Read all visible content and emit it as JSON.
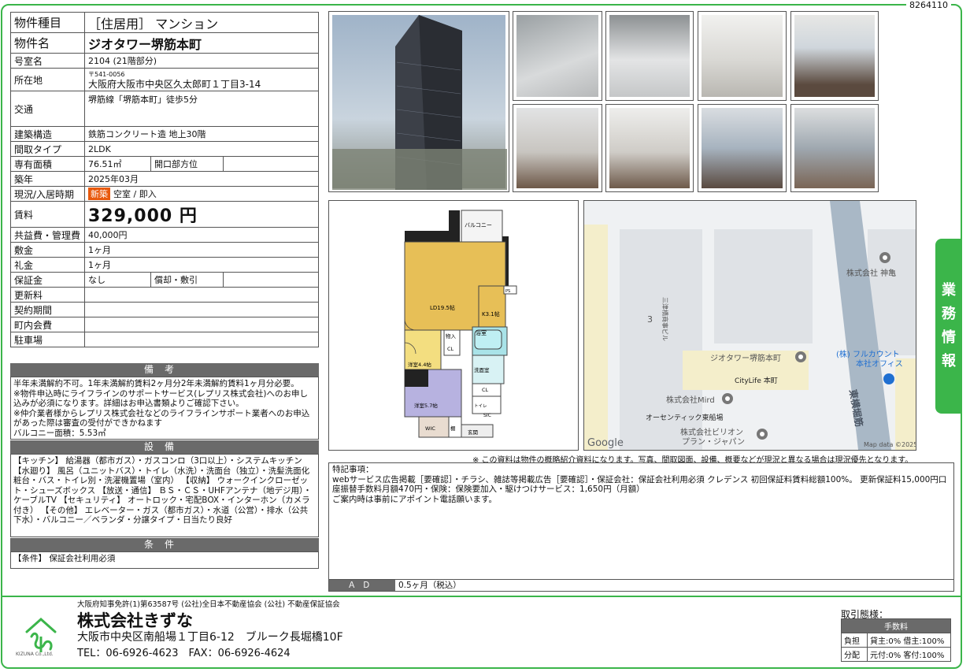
{
  "doc_id": "8264110",
  "property": {
    "rows": [
      {
        "label": "物件種目",
        "value": "［住居用］ マンション"
      },
      {
        "label": "物件名",
        "value": "ジオタワー堺筋本町"
      },
      {
        "label": "号室名",
        "value": "2104 (21階部分)"
      },
      {
        "label": "所在地",
        "postal": "〒541-0056",
        "value": "大阪府大阪市中央区久太郎町１丁目3-14"
      },
      {
        "label": "交通",
        "value": "堺筋線「堺筋本町」徒歩5分"
      },
      {
        "label": "建築構造",
        "value": "鉄筋コンクリート造 地上30階"
      },
      {
        "label": "間取タイプ",
        "value": "2LDK"
      },
      {
        "label": "専有面積",
        "value": "76.51㎡",
        "sub_label": "開口部方位",
        "sub_value": ""
      },
      {
        "label": "築年",
        "value": "2025年03月"
      },
      {
        "label": "現況/入居時期",
        "badge": "新築",
        "value": "空室 / 即入"
      },
      {
        "label": "賃料",
        "value": "329,000 円"
      },
      {
        "label": "共益費・管理費",
        "value": "40,000円"
      },
      {
        "label": "敷金",
        "value": "1ヶ月"
      },
      {
        "label": "礼金",
        "value": "1ヶ月"
      },
      {
        "label": "保証金",
        "value": "なし",
        "sub_label": "償却・敷引",
        "sub_value": ""
      },
      {
        "label": "更新料",
        "value": ""
      },
      {
        "label": "契約期間",
        "value": ""
      },
      {
        "label": "町内会費",
        "value": ""
      },
      {
        "label": "駐車場",
        "value": ""
      }
    ]
  },
  "remarks": {
    "title": "備考",
    "text": "半年未満解約不可。1年未満解約賃料2ヶ月分2年未満解約賃料1ヶ月分必要。\n※物件申込時にライフラインのサポートサービス(レプリス株式会社)へのお申し込みが必須になります。詳細はお申込書類よりご確認下さい。\n※仲介業者様からレプリス株式会社などのライフラインサポート業者へのお申込があった際は審査の受付ができかねます\nバルコニー面積：5.53㎡"
  },
  "equipment": {
    "title": "設備",
    "text": "【キッチン】 給湯器（都市ガス）・ガスコンロ（3口以上）・システムキッチン 【水廻り】 風呂（ユニットバス）・トイレ（水洗）・洗面台（独立）・洗髪洗面化粧台・バス・トイレ別・洗濯機置場（室内） 【収納】 ウォークインクローゼット・シューズボックス 【放送・通信】 ＢＳ・ＣＳ・UHFアンテナ（地デジ用）・ケーブルTV 【セキュリティ】 オートロック・宅配BOX・インターホン（カメラ付き） 【その他】 エレベーター・ガス（都市ガス）・水道（公営）・排水（公共下水）・バルコニー／ベランダ・分譲タイプ・日当たり良好"
  },
  "conditions": {
    "title": "条件",
    "text": "【条件】 保証会社利用必須"
  },
  "floorplan": {
    "balcony": "バルコニー",
    "ldk": "LD19.5帖",
    "kitchen": "K3.1帖",
    "ps": "PS",
    "storage": "物入",
    "cl1": "CL",
    "bath": "浴室",
    "room1": "洋室4.4帖",
    "wash": "洗面室",
    "cl2": "CL",
    "room2": "洋室5.7帖",
    "toilet": "トイレ",
    "sic": "SIC",
    "wic": "WIC",
    "shelf": "棚",
    "entrance": "玄関"
  },
  "map": {
    "labels": {
      "kamikame": "株式会社 神亀",
      "bldg": "三津橋商事ビル",
      "num": "3",
      "target": "ジオタワー堺筋本町",
      "fullcount1": "(株) フルカウント",
      "fullcount2": "本社オフィス",
      "citylife": "CityLife 本町",
      "mird": "株式会社Mird",
      "osentic": "オーセンティック東船場",
      "billion1": "株式会社ビリオン",
      "billion2": "プラン・ジャパン",
      "road": "東横堀筋",
      "google": "Google",
      "copyright": "Map data ©2025"
    }
  },
  "disclaimer": "※ この資料は物件の概略紹介資料になります。写真、間取図面、設備、概要などが現況と異なる場合は現況優先となります。",
  "special": {
    "title": "特記事項：",
    "text": "webサービス広告掲載［要確認］・チラシ、雑誌等掲載広告［要確認］・保証会社：保証会社利用必須 クレデンス 初回保証料賃料総額100%。 更新保証料15,000円口座振替手数料月額470円・保険：保険要加入・駆けつけサービス：1,650円（月額）\nご案内時は事前にアポイント電話願います。"
  },
  "ad": {
    "label": "ＡＤ",
    "value": "0.5ヶ月（税込）"
  },
  "side_tab": [
    "業",
    "務",
    "情",
    "報"
  ],
  "company": {
    "license": "大阪府知事免許(1)第63587号 (公社)全日本不動産協会 (公社) 不動産保証協会",
    "name": "株式会社きずな",
    "address": "大阪市中央区南船場１丁目6-12　ブルーク長堀橋10F",
    "tel": "TEL：06-6926-4623　FAX：06-6926-4624",
    "logo_text": "KIZUNA Co.,Ltd."
  },
  "transaction": {
    "title": "取引態様：",
    "fee_header": "手数料",
    "rows": [
      {
        "label": "負担",
        "value": "貸主:0% 借主:100%"
      },
      {
        "label": "分配",
        "value": "元付:0% 客付:100%"
      }
    ]
  },
  "colors": {
    "accent": "#3bb54a",
    "header_gray": "#6a6a6a",
    "badge": "#e8590c"
  }
}
